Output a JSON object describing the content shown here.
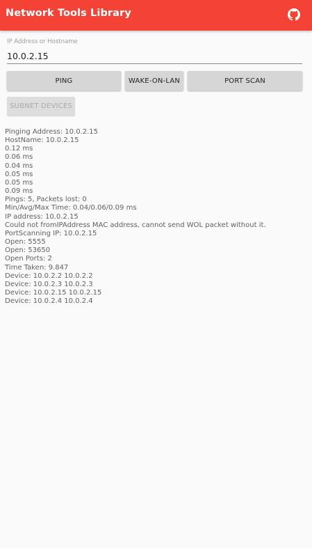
{
  "app_bar": {
    "title": "Network Tools Library",
    "background": "#f44336",
    "action_icon": "github-icon"
  },
  "address_field": {
    "label": "IP Address or Hostname",
    "value": "10.0.2.15"
  },
  "buttons": {
    "ping": "PING",
    "wake_on_lan": "WAKE-ON-LAN",
    "port_scan": "PORT SCAN",
    "subnet_devices": "SUBNET DEVICES",
    "subnet_devices_enabled": false
  },
  "output_lines": [
    "Pinging Address: 10.0.2.15",
    "HostName: 10.0.2.15",
    "0.12 ms",
    "0.06 ms",
    "0.04 ms",
    "0.05 ms",
    "0.05 ms",
    "0.09 ms",
    "Pings: 5, Packets lost: 0",
    "Min/Avg/Max Time: 0.04/0.06/0.09 ms",
    "IP address: 10.0.2.15",
    "Could not fromIPAddress MAC address, cannot send WOL packet without it.",
    "PortScanning IP: 10.0.2.15",
    "Open: 5555",
    "Open: 53650",
    "Open Ports: 2",
    "Time Taken: 9.847",
    "Device: 10.0.2.2 10.0.2.2",
    "Device: 10.0.2.3 10.0.2.3",
    "Device: 10.0.2.15 10.0.2.15",
    "Device: 10.0.2.4 10.0.2.4"
  ]
}
